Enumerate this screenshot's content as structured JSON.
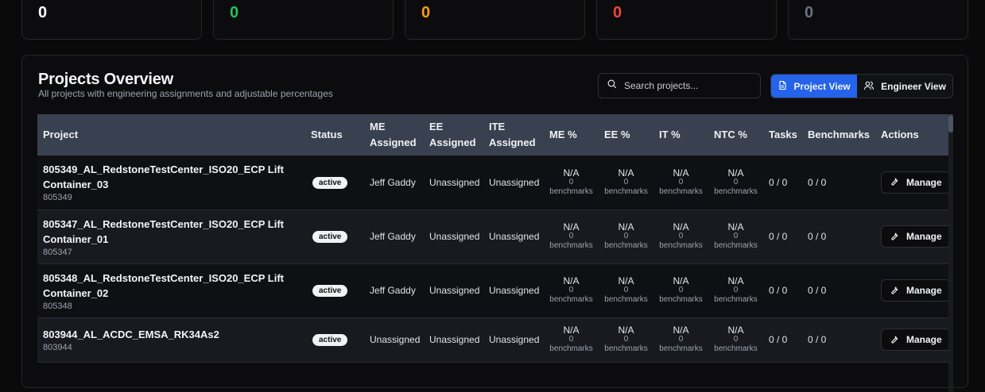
{
  "stats": [
    {
      "value": "0",
      "color": "#ffffff"
    },
    {
      "value": "0",
      "color": "#22c55e"
    },
    {
      "value": "0",
      "color": "#f59e0b"
    },
    {
      "value": "0",
      "color": "#ef4444"
    },
    {
      "value": "0",
      "color": "#6b7280"
    }
  ],
  "panel": {
    "title": "Projects Overview",
    "subtitle": "All projects with engineering assignments and adjustable percentages"
  },
  "search": {
    "placeholder": "Search projects...",
    "value": ""
  },
  "view_toggle": {
    "project_view": "Project View",
    "engineer_view": "Engineer View"
  },
  "table": {
    "headers": {
      "project": "Project",
      "status": "Status",
      "me_assigned_1": "ME",
      "me_assigned_2": "Assigned",
      "ee_assigned_1": "EE",
      "ee_assigned_2": "Assigned",
      "ite_assigned_1": "ITE",
      "ite_assigned_2": "Assigned",
      "me_pct": "ME %",
      "ee_pct": "EE %",
      "it_pct": "IT %",
      "ntc_pct": "NTC %",
      "tasks": "Tasks",
      "benchmarks": "Benchmarks",
      "actions": "Actions"
    },
    "rows": [
      {
        "name_1": "805349_AL_RedstoneTestCenter_ISO20_ECP Lift",
        "name_2": "Container_03",
        "id": "805349",
        "status": "active",
        "me": "Jeff Gaddy",
        "ee": "Unassigned",
        "ite": "Unassigned",
        "pct": "N/A",
        "bench_count": "0",
        "bench_label": "benchmarks",
        "tasks": "0 / 0",
        "benchmarks": "0 / 0",
        "action": "Manage"
      },
      {
        "name_1": "805347_AL_RedstoneTestCenter_ISO20_ECP Lift",
        "name_2": "Container_01",
        "id": "805347",
        "status": "active",
        "me": "Jeff Gaddy",
        "ee": "Unassigned",
        "ite": "Unassigned",
        "pct": "N/A",
        "bench_count": "0",
        "bench_label": "benchmarks",
        "tasks": "0 / 0",
        "benchmarks": "0 / 0",
        "action": "Manage"
      },
      {
        "name_1": "805348_AL_RedstoneTestCenter_ISO20_ECP Lift",
        "name_2": "Container_02",
        "id": "805348",
        "status": "active",
        "me": "Jeff Gaddy",
        "ee": "Unassigned",
        "ite": "Unassigned",
        "pct": "N/A",
        "bench_count": "0",
        "bench_label": "benchmarks",
        "tasks": "0 / 0",
        "benchmarks": "0 / 0",
        "action": "Manage"
      },
      {
        "name_1": "803944_AL_ACDC_EMSA_RK34As2",
        "name_2": "",
        "id": "803944",
        "status": "active",
        "me": "Unassigned",
        "ee": "Unassigned",
        "ite": "Unassigned",
        "pct": "N/A",
        "bench_count": "0",
        "bench_label": "benchmarks",
        "tasks": "0 / 0",
        "benchmarks": "0 / 0",
        "action": "Manage"
      }
    ]
  }
}
